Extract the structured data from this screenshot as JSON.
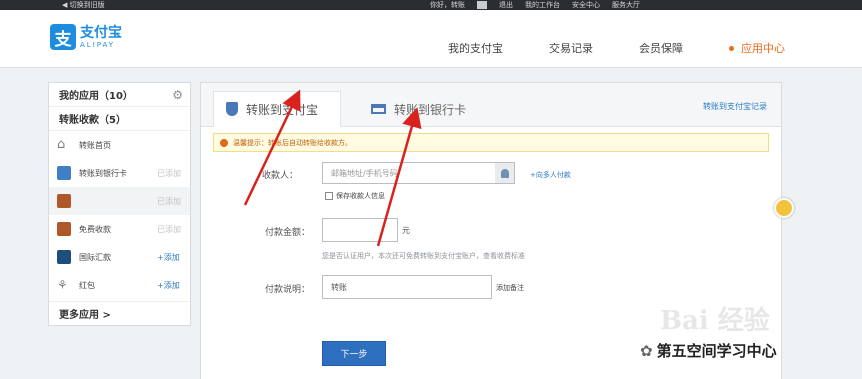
{
  "topbar": {
    "left": "◀ 切换到旧版",
    "items": [
      "你好，转账",
      "退出",
      "我的工作台",
      "安全中心",
      "服务大厅"
    ]
  },
  "header": {
    "logo_cn": "支付宝",
    "logo_en": "ALIPAY",
    "logo_glyph": "支",
    "nav": [
      "我的支付宝",
      "交易记录",
      "会员保障",
      "应用中心"
    ]
  },
  "sidebar": {
    "my_apps": "我的应用（10）",
    "transfer_group": "转账收款（5）",
    "items": [
      {
        "label": "转账首页",
        "action": "",
        "icon_color": "#7a7f86"
      },
      {
        "label": "转账到银行卡",
        "action": "已添加",
        "icon_color": "#3f7fc8"
      },
      {
        "label": "",
        "action": "已添加",
        "icon_color": "#b0572a"
      },
      {
        "label": "免费收款",
        "action": "已添加",
        "icon_color": "#b0572a"
      },
      {
        "label": "国际汇款",
        "action": "+添加",
        "icon_color": "#1d4e7d"
      },
      {
        "label": "红包",
        "action": "+添加",
        "icon_color": "#7a7f86"
      }
    ],
    "more": "更多应用 >"
  },
  "tabs": {
    "tab1": "转账到支付宝",
    "tab2": "转账到银行卡",
    "link": "转账到支付宝记录"
  },
  "notice": "温馨提示：转账后自动转账给收款方。",
  "form": {
    "payee_label": "收款人：",
    "payee_placeholder": "邮箱地址/手机号码",
    "multi_link": "+向多人付款",
    "save_contact": "保存收款人信息",
    "amount_label": "付款金额：",
    "amount_unit": "元",
    "amount_hint": "您是否认证用户，本次还可免费转账到支付宝账户，查看收费标准",
    "memo_label": "付款说明：",
    "memo_value": "转账",
    "memo_link": "添加备注",
    "next": "下一步"
  },
  "watermark": {
    "text": "第五空间学习中心",
    "baidu": "Bai 经验"
  },
  "colors": {
    "brand": "#1e8de0",
    "accent": "#e86d1c",
    "button": "#2f6fbf",
    "arrow": "#d8221e"
  }
}
